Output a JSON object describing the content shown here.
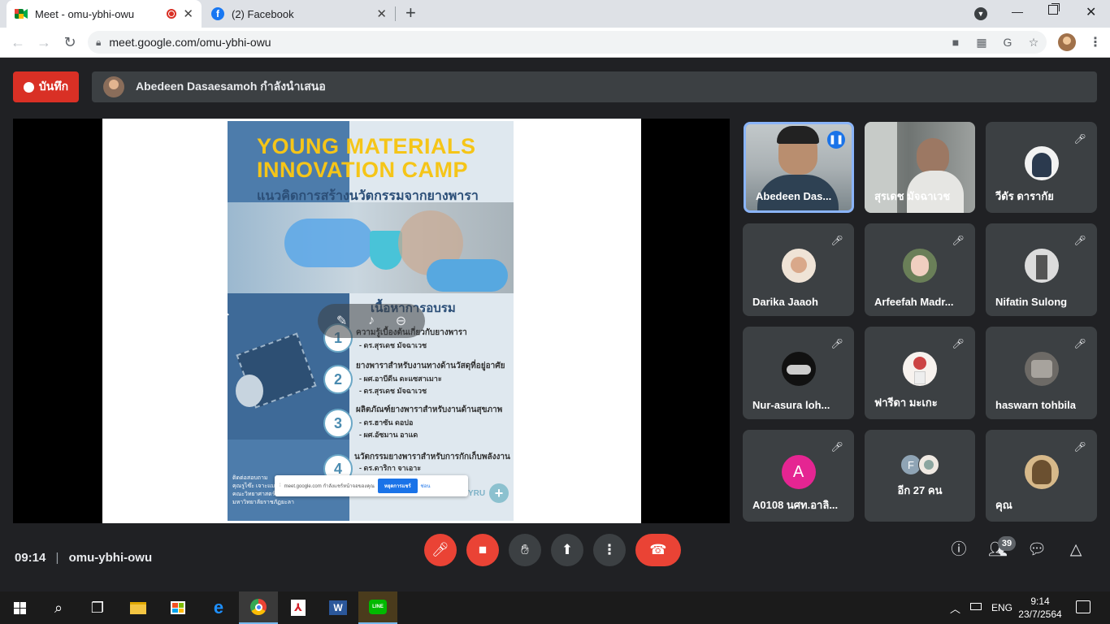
{
  "browser": {
    "tabs": [
      {
        "title": "Meet - omu-ybhi-owu",
        "close": "✕"
      },
      {
        "title": "(2) Facebook",
        "close": "✕"
      }
    ],
    "url": "meet.google.com/omu-ybhi-owu"
  },
  "meet": {
    "record_label": "บันทึก",
    "presenter_text": "Abedeen Dasaesamoh กำลังนำเสนอ",
    "meeting_time": "09:14",
    "meeting_code": "omu-ybhi-owu",
    "participant_count": "39",
    "participants": [
      {
        "name": "Abedeen Das...",
        "type": "video",
        "speaking": true
      },
      {
        "name": "สุรเดช มัจฉาเวช",
        "type": "video"
      },
      {
        "name": "วีดัร ดารากัย",
        "type": "avatar",
        "muted": true
      },
      {
        "name": "Darika Jaaoh",
        "type": "avatar",
        "muted": true
      },
      {
        "name": "Arfeefah Madr...",
        "type": "avatar",
        "muted": true
      },
      {
        "name": "Nifatin Sulong",
        "type": "avatar",
        "muted": true
      },
      {
        "name": "Nur-asura loh...",
        "type": "avatar",
        "muted": true
      },
      {
        "name": "ฟารีดา มะเกะ",
        "type": "avatar",
        "muted": true
      },
      {
        "name": "haswarn tohbila",
        "type": "avatar",
        "muted": true
      },
      {
        "name": "A0108 นศท.อาลิ...",
        "type": "letter",
        "letter": "A",
        "muted": true
      },
      {
        "name": "อีก 27 คน",
        "type": "others",
        "letter": "F"
      },
      {
        "name": "คุณ",
        "type": "avatar",
        "muted": true
      }
    ],
    "share_banner": {
      "text": "meet.google.com กำลังแชร์หน้าจอของคุณ",
      "stop_label": "หยุดการแชร์",
      "hide_label": "ซ่อน"
    }
  },
  "poster": {
    "title_line1": "YOUNG MATERIALS",
    "title_line2": "INNOVATION CAMP",
    "subtitle": "แนวคิดการสร้างนวัตกรรมจากยางพารา",
    "section_title": "เนื้อหาการอบรม",
    "items": [
      {
        "num": "1",
        "title": "ความรู้เบื้องต้นเกี่ยวกับยางพารา",
        "lines": [
          "- ดร.สุรเดช  มัจฉาเวช"
        ]
      },
      {
        "num": "2",
        "title": "ยางพาราสำหรับงานทางด้านวัสดุที่อยู่อาศัย",
        "lines": [
          "- ผศ.อาบีดีน  ดะแซสาเมาะ",
          "- ดร.สุรเดช  มัจฉาเวช"
        ]
      },
      {
        "num": "3",
        "title": "ผลิตภัณฑ์ยางพาราสำหรับงานด้านสุขภาพ",
        "lines": [
          "- ดร.ฮาซัน  ดอปอ",
          "- ผศ.อัซมาน อาแด"
        ]
      },
      {
        "num": "4",
        "title": "นวัตกรรมยางพาราสำหรับการกักเก็บพลังงาน",
        "lines": [
          "- ดร.ดาริกา  จาเอาะ"
        ]
      }
    ],
    "contact_lines": [
      "ติดต่อสอบถาม",
      "คุณรูไซ๊ะ เจาะแม",
      "คณะวิทยาศาสตร์เทคโนโลยีและการเกษตร",
      "มหาวิทยาลัยราชภัฏยะลา"
    ],
    "footer_text": "YRU"
  },
  "taskbar": {
    "time": "9:14",
    "date": "23/7/2564",
    "lang": "ENG"
  },
  "colors": {
    "accent_red": "#ea4335",
    "meet_bg": "#202124",
    "tile_bg": "#3c4043",
    "poster_yellow": "#f5c518",
    "poster_blue": "#3f6f9f",
    "line_green": "#00b900"
  }
}
